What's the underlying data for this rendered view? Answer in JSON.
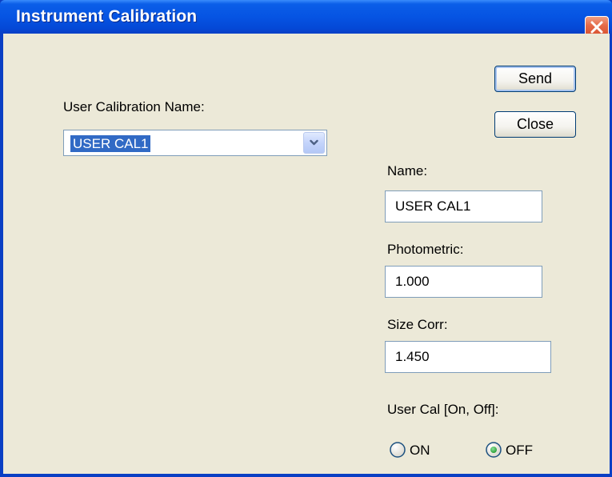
{
  "window": {
    "title": "Instrument Calibration",
    "close_icon": "close-icon"
  },
  "calibration_select": {
    "label": "User Calibration Name:",
    "selected_value": "USER CAL1"
  },
  "buttons": {
    "send_label": "Send",
    "close_label": "Close"
  },
  "fields": {
    "name_label": "Name:",
    "name_value": "USER CAL1",
    "photometric_label": "Photometric:",
    "photometric_value": "1.000",
    "size_corr_label": "Size Corr:",
    "size_corr_value": "1.450"
  },
  "user_cal": {
    "label": "User Cal [On, Off]:",
    "on_label": "ON",
    "off_label": "OFF",
    "selected": "OFF"
  },
  "colors": {
    "titlebar": "#0654e3",
    "dialog_bg": "#ece9d8",
    "selection": "#316ac5",
    "close_button": "#d44a28"
  }
}
